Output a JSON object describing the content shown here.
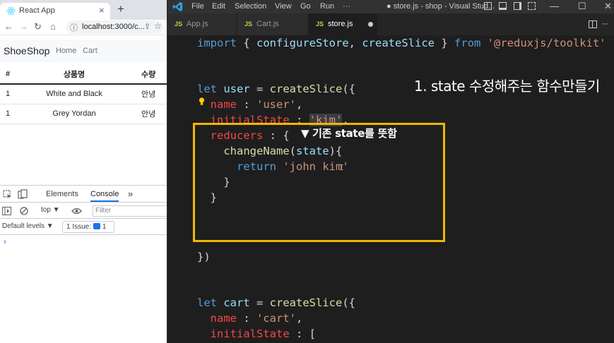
{
  "browser": {
    "tab_title": "React App",
    "tab_close": "×",
    "new_tab": "+",
    "nav": {
      "back": "←",
      "forward": "→",
      "reload": "↻",
      "home": "⌂",
      "info_icon": "ⓘ",
      "share_icon": "⇪",
      "star_icon": "☆"
    },
    "url": "localhost:3000/c..."
  },
  "app": {
    "brand": "ShoeShop",
    "nav_links": [
      "Home",
      "Cart"
    ],
    "table": {
      "headers": [
        "#",
        "상품명",
        "수량"
      ],
      "rows": [
        [
          "1",
          "White and Black",
          "안녕"
        ],
        [
          "1",
          "Grey Yordan",
          "안녕"
        ]
      ]
    }
  },
  "devtools": {
    "tabs": [
      "Elements",
      "Console"
    ],
    "active_tab": "Console",
    "more_tabs": "»",
    "context": "top ▼",
    "filter_placeholder": "Filter",
    "levels": "Default levels ▼",
    "issues": "1 Issue:",
    "issues_count": "1",
    "prompt": "›"
  },
  "vscode": {
    "menu": [
      "File",
      "Edit",
      "Selection",
      "View",
      "Go",
      "Run",
      "···"
    ],
    "window_title": "● store.js - shop - Visual Stud...",
    "window_controls": {
      "minimize": "—",
      "maximize": "☐",
      "close": "✕"
    },
    "tabs": [
      {
        "icon": "JS",
        "name": "App.js"
      },
      {
        "icon": "JS",
        "name": "Cart.js"
      },
      {
        "icon": "JS",
        "name": "store.js",
        "active": true,
        "modified": true
      }
    ],
    "more_actions": "···",
    "code": {
      "line1": {
        "kw1": "import",
        "p1": " { ",
        "fn1": "configureStore",
        "p2": ", ",
        "fn2": "createSlice",
        "p3": " } ",
        "kw2": "from",
        "p4": " ",
        "str": "'@reduxjs/toolkit'"
      },
      "line2": {
        "kw": "let",
        "p1": " ",
        "var": "user",
        "p2": " = ",
        "fn": "createSlice",
        "p3": "({"
      },
      "line3": {
        "indent": "  ",
        "prop": "name",
        "p1": " : ",
        "str": "'user'",
        "p2": ","
      },
      "line4": {
        "indent": "  ",
        "prop": "initialState",
        "p1": " : ",
        "str": "'kim'",
        "p2": ","
      },
      "line5": {
        "indent": "  ",
        "prop": "reducers",
        "p1": " : {"
      },
      "line6": {
        "indent": "    ",
        "fn": "changeName",
        "p1": "(",
        "var": "state",
        "p2": "){"
      },
      "line7": {
        "indent": "      ",
        "kw": "return",
        "p1": " ",
        "str": "'john kim'"
      },
      "line8": {
        "text": "    }"
      },
      "line9": {
        "text": "  }"
      },
      "line10": {
        "text": "})"
      },
      "line11": {
        "kw": "let",
        "p1": " ",
        "var": "cart",
        "p2": " = ",
        "fn": "createSlice",
        "p3": "({"
      },
      "line12": {
        "indent": "  ",
        "prop": "name",
        "p1": " : ",
        "str": "'cart'",
        "p2": ","
      },
      "line13": {
        "indent": "  ",
        "prop": "initialState",
        "p1": " : ["
      }
    },
    "annotation_title": "1. state 수정해주는 함수만들기",
    "annotation_note": "▼ 기존 state를 뜻함",
    "text_cursor": "I"
  },
  "colors": {
    "highlight_box": "#f2b600",
    "keyword": "#569cd6",
    "string": "#ce9178",
    "function": "#dcdcaa",
    "property": "#f44747",
    "variable": "#9cdcfe",
    "editor_bg": "#1e1e1e"
  }
}
